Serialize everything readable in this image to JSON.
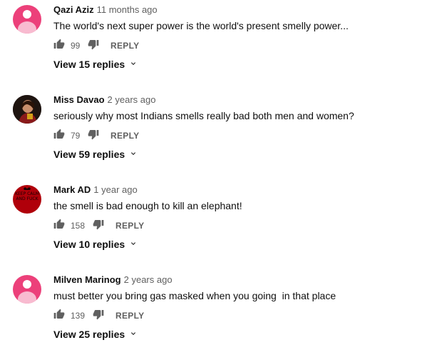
{
  "comments": [
    {
      "author": "Qazi Aziz",
      "time": "11 months ago",
      "text": "The world's next super power is the world's present smelly power...",
      "likes": "99",
      "reply_label": "REPLY",
      "view_replies": "View 15 replies",
      "avatar": "default-person-pink"
    },
    {
      "author": "Miss Davao",
      "time": "2 years ago",
      "text": "seriously why most Indians smells really bad both men and women?",
      "likes": "79",
      "reply_label": "REPLY",
      "view_replies": "View 59 replies",
      "avatar": "photo"
    },
    {
      "author": "Mark AD",
      "time": "1 year ago",
      "text": "the smell is bad enough to kill an elephant!",
      "likes": "158",
      "reply_label": "REPLY",
      "view_replies": "View 10 replies",
      "avatar": "keep-calm-red",
      "avatar_caption": "KEEP CALM AND FUCK"
    },
    {
      "author": "Milven Marinog",
      "time": "2 years ago",
      "text": "must better you bring gas masked when you going  in that place",
      "likes": "139",
      "reply_label": "REPLY",
      "view_replies": "View 25 replies",
      "avatar": "default-person-pink"
    }
  ],
  "colors": {
    "avatar_pink": "#ec407a",
    "secondary_text": "#606060",
    "primary_text": "#0f0f0f"
  },
  "icons": [
    "thumb-up-icon",
    "thumb-down-icon",
    "chevron-down-icon"
  ]
}
